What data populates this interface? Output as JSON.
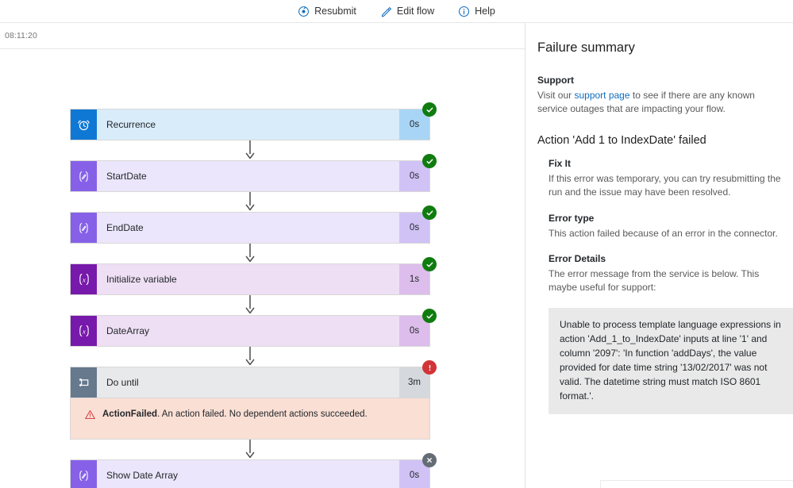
{
  "toolbar": {
    "items": [
      {
        "label": "Resubmit",
        "icon": "resubmit-icon"
      },
      {
        "label": "Edit flow",
        "icon": "pencil-icon"
      },
      {
        "label": "Help",
        "icon": "info-icon"
      }
    ]
  },
  "run": {
    "timestamp": "08:11:20"
  },
  "flow": {
    "steps": [
      {
        "name": "Recurrence",
        "duration": "0s",
        "status": "succeeded",
        "icon": "alarm-clock-icon",
        "icon_bg": "#0f78d4",
        "card_bg": "#d9ecfa",
        "dur_bg": "#a8d5f5"
      },
      {
        "name": "StartDate",
        "duration": "0s",
        "status": "succeeded",
        "icon": "compose-icon",
        "icon_bg": "#8661e8",
        "card_bg": "#ebe6fb",
        "dur_bg": "#d0c2f5"
      },
      {
        "name": "EndDate",
        "duration": "0s",
        "status": "succeeded",
        "icon": "compose-icon",
        "icon_bg": "#8661e8",
        "card_bg": "#ebe6fb",
        "dur_bg": "#d0c2f5"
      },
      {
        "name": "Initialize variable",
        "duration": "1s",
        "status": "succeeded",
        "icon": "variable-icon",
        "icon_bg": "#7719aa",
        "card_bg": "#eedff5",
        "dur_bg": "#ddbdec"
      },
      {
        "name": "DateArray",
        "duration": "0s",
        "status": "succeeded",
        "icon": "variable-icon",
        "icon_bg": "#7719aa",
        "card_bg": "#eedff5",
        "dur_bg": "#ddbdec"
      },
      {
        "name": "Do until",
        "duration": "3m",
        "status": "failed",
        "icon": "loop-icon",
        "icon_bg": "#66798d",
        "card_bg": "#e7e9eb",
        "dur_bg": "#d5d9dd",
        "error": {
          "code": "ActionFailed",
          "message": ". An action failed. No dependent actions succeeded."
        }
      },
      {
        "name": "Show Date Array",
        "duration": "0s",
        "status": "skipped",
        "icon": "compose-icon",
        "icon_bg": "#8661e8",
        "card_bg": "#ebe6fb",
        "dur_bg": "#d0c2f5"
      }
    ]
  },
  "details": {
    "panel_title": "Failure summary",
    "support_heading": "Support",
    "support_text_before": "Visit our ",
    "support_link": "support page",
    "support_text_after": " to see if there are any known service outages that are impacting your flow.",
    "action_heading": "Action 'Add 1 to IndexDate' failed",
    "fixit_heading": "Fix It",
    "fixit_text": "If this error was temporary, you can try resubmitting the run and the issue may have been resolved.",
    "errortype_heading": "Error type",
    "errortype_text": "This action failed because of an error in the connector.",
    "errordetails_heading": "Error Details",
    "errordetails_text": "The error message from the service is below. This maybe useful for support:",
    "error_message": "Unable to process template language expressions in action 'Add_1_to_IndexDate' inputs at line '1' and column '2097': 'In function 'addDays', the value provided for date time string '13/02/2017' was not valid. The datetime string must match ISO 8601 format.'."
  },
  "colors": {
    "accent": "#0f6cbd",
    "success": "#107c10",
    "error": "#d13438",
    "skipped": "#646d76",
    "error_strip_bg": "#fadfd4"
  }
}
